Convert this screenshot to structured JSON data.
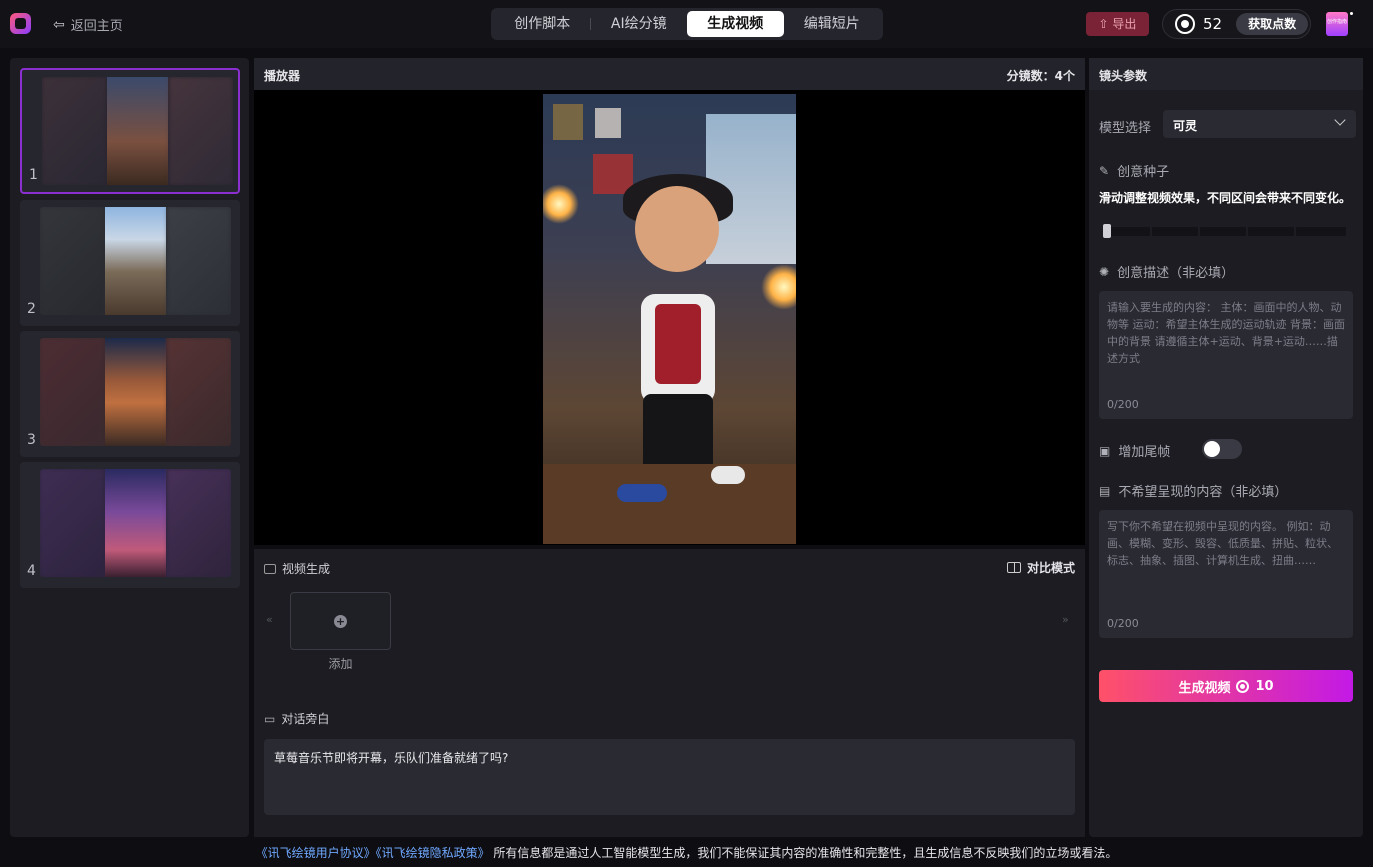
{
  "header": {
    "back_label": "返回主页",
    "tabs": [
      {
        "label": "创作脚本",
        "active": false
      },
      {
        "label": "AI绘分镜",
        "active": false
      },
      {
        "label": "生成视频",
        "active": true
      },
      {
        "label": "编辑短片",
        "active": false
      }
    ],
    "export_label": "导出",
    "points": "52",
    "get_points_label": "获取点数",
    "avatar_text": "创作指南"
  },
  "storyboard": {
    "items": [
      {
        "num": "1",
        "selected": true
      },
      {
        "num": "2",
        "selected": false
      },
      {
        "num": "3",
        "selected": false
      },
      {
        "num": "4",
        "selected": false
      }
    ]
  },
  "player": {
    "title": "播放器",
    "shot_count": "分镜数：4个"
  },
  "generation": {
    "title": "视频生成",
    "compare_label": "对比模式",
    "prev_arrow": "«",
    "next_arrow": "»",
    "add_label": "添加",
    "dialog_title": "对话旁白",
    "dialog_text": "草莓音乐节即将开幕，乐队们准备就绪了吗?"
  },
  "params": {
    "title": "镜头参数",
    "model_label": "模型选择",
    "model_value": "可灵",
    "seed_label": "创意种子",
    "seed_desc": "滑动调整视频效果，不同区间会带来不同变化。",
    "seed_value": 0.0,
    "desc_label": "创意描述（非必填）",
    "desc_placeholder": "请输入要生成的内容： 主体：画面中的人物、动物等 运动：希望主体生成的运动轨迹 背景：画面中的背景 请遵循主体+运动、背景+运动……描述方式",
    "desc_count": "0/200",
    "tail_label": "增加尾帧",
    "tail_enabled": false,
    "negative_label": "不希望呈现的内容（非必填）",
    "negative_placeholder": "写下你不希望在视频中呈现的内容。 例如：动画、模糊、变形、毁容、低质量、拼贴、粒状、标志、抽象、插图、计算机生成、扭曲……",
    "negative_count": "0/200",
    "generate_label": "生成视频",
    "generate_cost": "10"
  },
  "footer": {
    "agreement_link": "《讯飞绘镜用户协议》",
    "privacy_link": "《讯飞绘镜隐私政策》",
    "disclaimer": "所有信息都是通过人工智能模型生成，我们不能保证其内容的准确性和完整性，且生成信息不反映我们的立场或看法。"
  },
  "colors": {
    "accent_purple": "#8b2fd0",
    "generate_start": "#ff5168",
    "generate_end": "#c319e6",
    "export_bg": "#7a2336",
    "link": "#6fa8ff"
  }
}
